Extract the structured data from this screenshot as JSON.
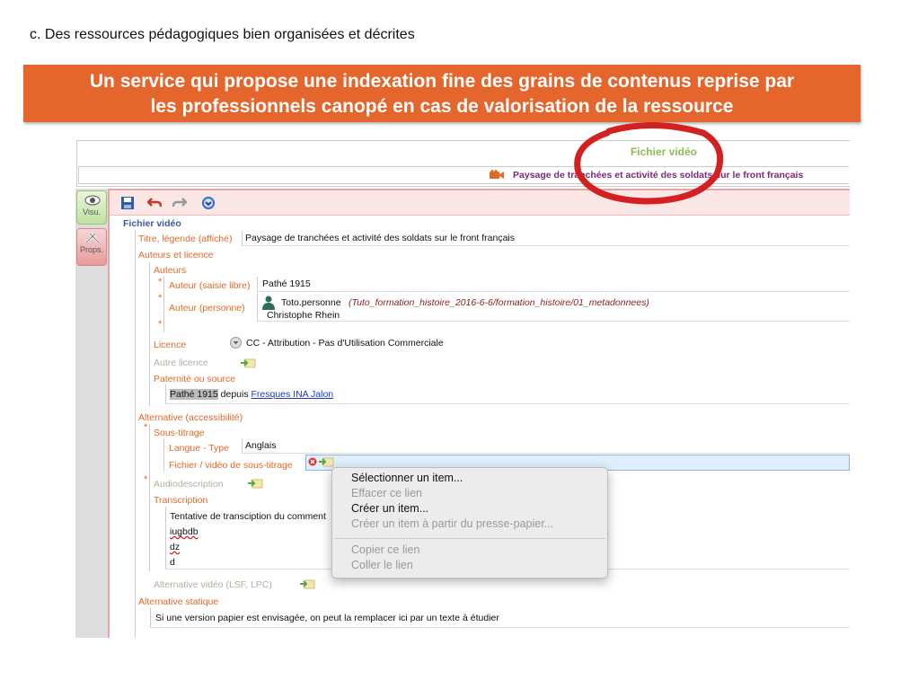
{
  "slide": {
    "title": "c. Des ressources pédagogiques bien organisées et décrites",
    "banner_line1": "Un service qui propose une indexation fine des grains de contenus reprise par",
    "banner_line2": "les professionnels canopé en cas de valorisation de la ressource"
  },
  "header": {
    "type_label": "Fichier vidéo",
    "resource_title": "Paysage de tranchées et activité des soldats sur le front français"
  },
  "tabs": {
    "visu": "Visu.",
    "props": "Props."
  },
  "form": {
    "section_title": "Fichier vidéo",
    "titre_label": "Titre, légende (affiché)",
    "titre_value": "Paysage de tranchées et activité des soldats sur le front français",
    "auteurs_licence_label": "Auteurs et licence",
    "auteurs_label": "Auteurs",
    "auteur_libre_label": "Auteur (saisie libre)",
    "auteur_libre_value": "Pathé 1915",
    "auteur_personne_label": "Auteur (personne)",
    "auteur_personne_id": "Toto.personne",
    "auteur_personne_path": "(Tuto_formation_histoire_2016-6-6/formation_histoire/01_metadonnees)",
    "auteur_personne_name": "Christophe  Rhein",
    "licence_label": "Licence",
    "licence_value": "CC - Attribution - Pas d'Utilisation Commerciale",
    "autre_licence_label": "Autre licence",
    "paternite_label": "Paternité ou source",
    "paternite_highlight": "Pathé 1915",
    "paternite_mid": " depuis ",
    "paternite_link": "Fresques INA Jalon",
    "alternative_label": "Alternative (accessibilité)",
    "sous_titrage_label": "Sous-titrage",
    "langue_label": "Langue - Type",
    "langue_value": "Anglais",
    "fichier_sous_titrage_label": "Fichier / vidéo de sous-titrage",
    "audiodescription_label": "Audiodescription",
    "transcription_label": "Transcription",
    "transcription_lines": [
      "Tentative de transciption du comment",
      "iugbdb",
      "dz",
      "d"
    ],
    "alt_video_label": "Alternative vidéo (LSF, LPC)",
    "alt_statique_label": "Alternative statique",
    "alt_statique_value": "Si une version papier est envisagée, on peut la remplacer ici par un texte à étudier"
  },
  "context_menu": {
    "items": [
      {
        "label": "Sélectionner un item...",
        "enabled": true
      },
      {
        "label": "Effacer ce lien",
        "enabled": false
      },
      {
        "label": "Créer un item...",
        "enabled": true
      },
      {
        "label": "Créer un item à partir du presse-papier...",
        "enabled": false
      },
      {
        "label": "Copier ce lien",
        "enabled": false
      },
      {
        "label": "Coller le lien",
        "enabled": false
      }
    ]
  },
  "colors": {
    "banner": "#e5662c",
    "label_orange": "#e06a28",
    "annotation_red": "#d32020",
    "header_green": "#8dbb59"
  }
}
